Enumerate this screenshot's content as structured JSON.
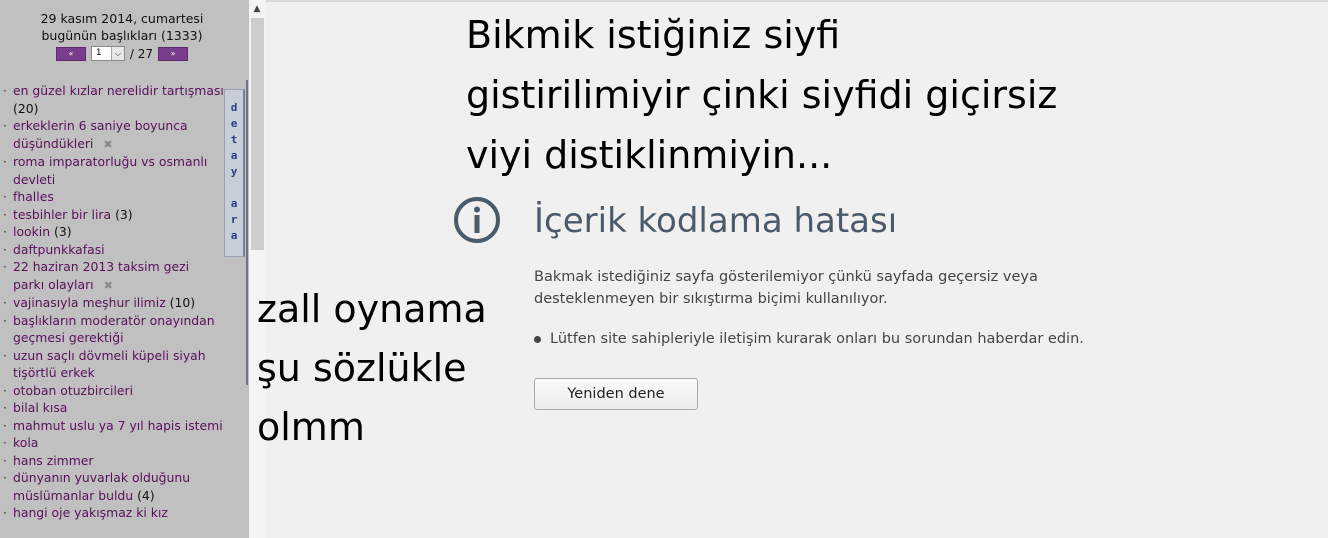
{
  "sidebar": {
    "date": "29 kasım 2014, cumartesi",
    "today_label": "bugünün başlıkları (1333)",
    "pager": {
      "prev_label": "«",
      "next_label": "»",
      "current_page": "1",
      "total": "/ 27"
    },
    "detay_label": [
      "d",
      "e",
      "t",
      "a",
      "y",
      "",
      "a",
      "r",
      "a"
    ],
    "topics": [
      {
        "title": "en güzel kızlar nerelidir tartışması",
        "count": "(20)",
        "removable": false
      },
      {
        "title": "erkeklerin 6 saniye boyunca düşündükleri",
        "count": "",
        "removable": true
      },
      {
        "title": "roma imparatorluğu vs osmanlı devleti",
        "count": "",
        "removable": false
      },
      {
        "title": "fhalles",
        "count": "",
        "removable": false
      },
      {
        "title": "tesbihler bir lira",
        "count": "(3)",
        "removable": false
      },
      {
        "title": "lookin",
        "count": "(3)",
        "removable": false
      },
      {
        "title": "daftpunkkafasi",
        "count": "",
        "removable": false
      },
      {
        "title": "22 haziran 2013 taksim gezi parkı olayları",
        "count": "",
        "removable": true
      },
      {
        "title": "vajinasıyla meşhur ilimiz",
        "count": "(10)",
        "removable": false
      },
      {
        "title": "başlıkların moderatör onayından geçmesi gerektiği",
        "count": "",
        "removable": false
      },
      {
        "title": "uzun saçlı dövmeli küpeli siyah tişörtlü erkek",
        "count": "",
        "removable": false
      },
      {
        "title": "otoban otuzbircileri",
        "count": "",
        "removable": false
      },
      {
        "title": "bilal kısa",
        "count": "",
        "removable": false
      },
      {
        "title": "mahmut uslu ya 7 yıl hapis istemi",
        "count": "",
        "removable": false
      },
      {
        "title": "kola",
        "count": "",
        "removable": false
      },
      {
        "title": "hans zimmer",
        "count": "",
        "removable": false
      },
      {
        "title": "dünyanın yuvarlak olduğunu müslümanlar buldu",
        "count": "(4)",
        "removable": false
      },
      {
        "title": "hangi oje yakışmaz ki kız",
        "count": "",
        "removable": false
      }
    ]
  },
  "meme": {
    "top_lines": [
      "Bikmik istiğiniz siyfi",
      "gistirilimiyir çinki siyfidi giçirsiz",
      "viyi distiklinmiyin..."
    ],
    "left_lines": [
      "zall oynama",
      "şu sözlükle",
      "olmm"
    ]
  },
  "error_page": {
    "icon": "info-icon",
    "title": "İçerik kodlama hatası",
    "description": "Bakmak istediğiniz sayfa gösterilemiyor çünkü sayfada geçersiz veya desteklenmeyen bir sıkıştırma biçimi kullanılıyor.",
    "suggestion": "Lütfen site sahipleriyle iletişim kurarak onları bu sorundan haberdar edin.",
    "retry_label": "Yeniden dene"
  },
  "colors": {
    "sidebar_bg": "#c0c0c0",
    "link": "#5a0f5c",
    "pager_button": "#7a3c8c",
    "error_title": "#4a5a6a",
    "page_bg": "#f0f0f0"
  }
}
